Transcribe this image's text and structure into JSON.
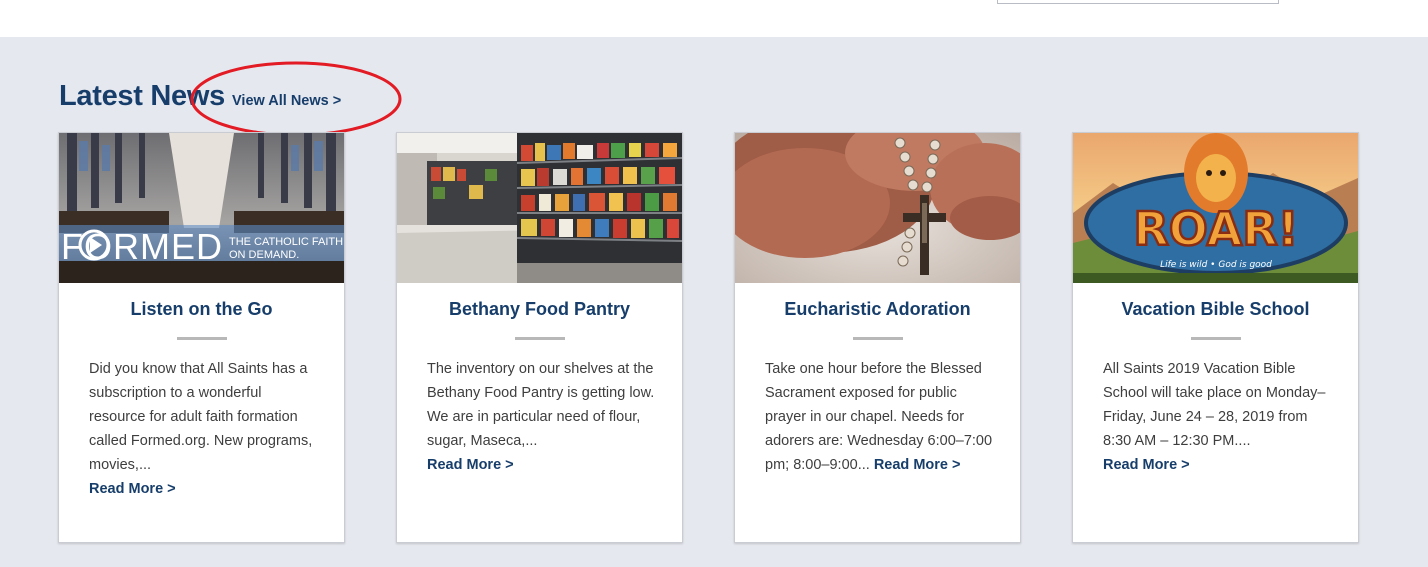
{
  "section": {
    "title": "Latest News",
    "view_all_label": "View All News >"
  },
  "cards": [
    {
      "title": "Listen on the Go",
      "text": "Did you know that All Saints has a subscription to a wonderful resource for adult faith formation called Formed.org. New programs, movies,...",
      "read_more": "Read More >",
      "image": {
        "brand": "FORMED",
        "tagline_1": "THE CATHOLIC FAITH",
        "tagline_2": "ON DEMAND."
      }
    },
    {
      "title": "Bethany Food Pantry",
      "text": "The inventory on our shelves at the Bethany Food Pantry is getting low.  We are in particular need of flour, sugar, Maseca,...",
      "read_more": "Read More >"
    },
    {
      "title": "Eucharistic Adoration",
      "text": "Take one hour before the Blessed Sacrament exposed for public prayer in our chapel. Needs for adorers are: Wednesday 6:00–7:00 pm; 8:00–9:00...",
      "read_more": "Read More >"
    },
    {
      "title": "Vacation Bible School",
      "text": "All Saints 2019 Vacation Bible School will take place on Monday–Friday, June 24 – 28, 2019 from 8:30 AM – 12:30 PM....",
      "read_more": "Read More >",
      "image": {
        "logo_text": "ROAR!",
        "tagline": "Life is wild • God is good"
      }
    }
  ],
  "colors": {
    "brand_blue": "#173e6b",
    "page_bg": "#e6e8ef",
    "annotation_red": "#e21b24"
  }
}
